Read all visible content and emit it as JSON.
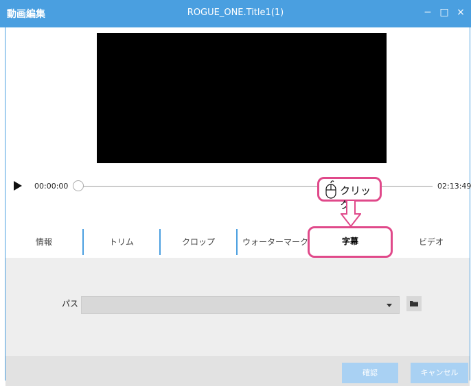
{
  "window": {
    "app_title": "動画編集",
    "title": "ROGUE_ONE.Title1(1)",
    "controls": [
      "−",
      "□",
      "×"
    ]
  },
  "player": {
    "time_current": "00:00:00",
    "time_total": "02:13:49",
    "progress_percent": 0
  },
  "annotation": {
    "click_label": "クリック"
  },
  "tabs": [
    {
      "label": "情報"
    },
    {
      "label": "トリム"
    },
    {
      "label": "クロップ"
    },
    {
      "label": "ウォーターマーク"
    },
    {
      "label": "字幕",
      "active": true
    },
    {
      "label": "ビデオ"
    }
  ],
  "subtitle": {
    "path_label": "パス",
    "path_value": ""
  },
  "footer": {
    "confirm_label": "確認",
    "cancel_label": "キャンセル"
  },
  "colors": {
    "titlebar": "#4a9fe0",
    "highlight": "#e0498a",
    "button": "#a9d1f3"
  }
}
